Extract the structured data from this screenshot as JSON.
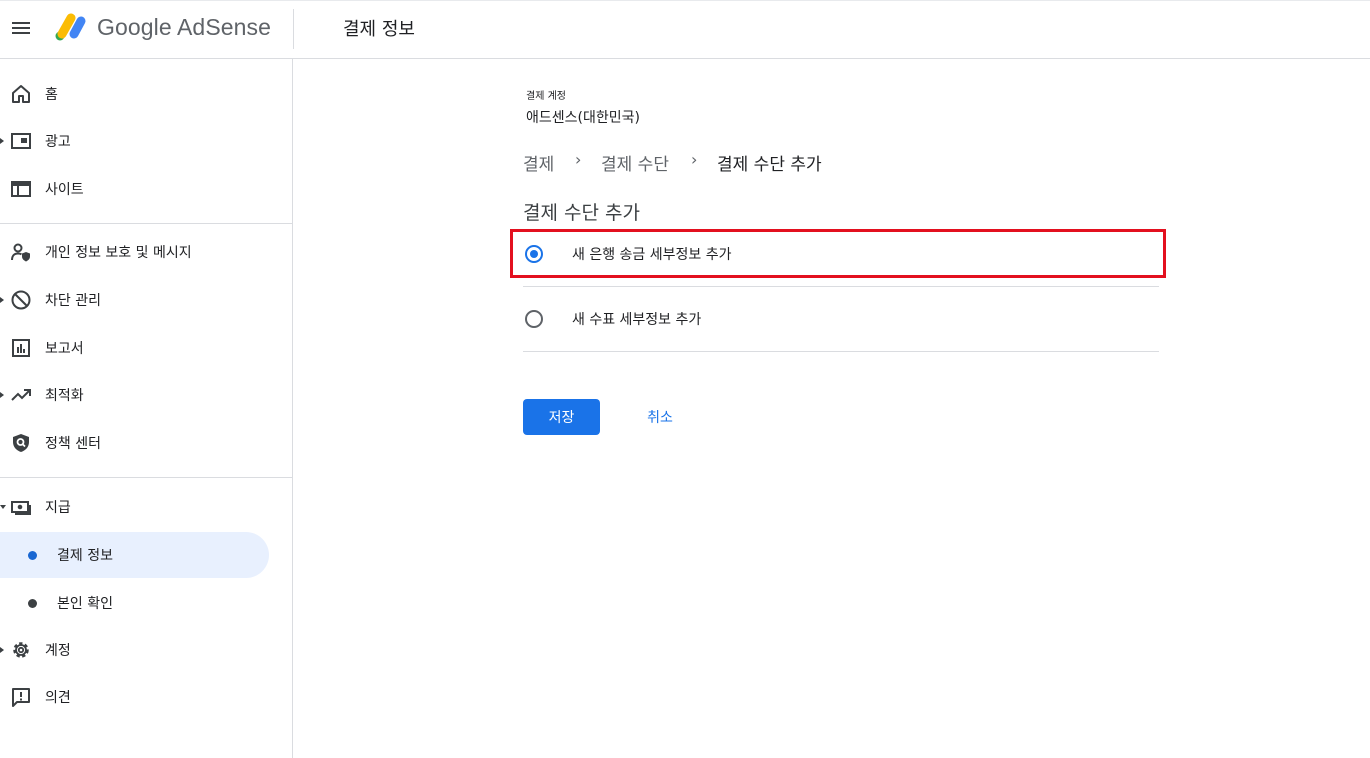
{
  "app": {
    "logo_text": "Google AdSense",
    "page_title": "결제 정보"
  },
  "colors": {
    "accent": "#1a73e8",
    "active_bg": "#e8f0fe",
    "highlight_border": "#e3101f",
    "logo_yellow": "#fbbc04",
    "logo_blue": "#4285f4",
    "logo_green": "#34a853"
  },
  "sidebar": {
    "items": [
      {
        "label": "홈",
        "icon": "home-icon"
      },
      {
        "label": "광고",
        "icon": "ads-icon",
        "caret": "right"
      },
      {
        "label": "사이트",
        "icon": "sites-icon"
      },
      {
        "label": "개인 정보 보호 및 메시지",
        "icon": "privacy-icon"
      },
      {
        "label": "차단 관리",
        "icon": "block-icon",
        "caret": "right"
      },
      {
        "label": "보고서",
        "icon": "reports-icon"
      },
      {
        "label": "최적화",
        "icon": "optimization-icon",
        "caret": "right"
      },
      {
        "label": "정책 센터",
        "icon": "policy-shield-icon"
      },
      {
        "label": "지급",
        "icon": "payments-icon",
        "caret": "down"
      },
      {
        "label": "계정",
        "icon": "gear-icon",
        "caret": "right"
      },
      {
        "label": "의견",
        "icon": "feedback-icon"
      }
    ],
    "payments_subitems": [
      {
        "label": "결제 정보",
        "active": true
      },
      {
        "label": "본인 확인",
        "active": false
      }
    ]
  },
  "main": {
    "account_label": "결제 계정",
    "account_name": "애드센스(대한민국)",
    "breadcrumb": [
      "결제",
      "결제 수단",
      "결제 수단 추가"
    ],
    "breadcrumb_separator": "›",
    "section_title": "결제 수단 추가",
    "options": [
      {
        "label": "새 은행 송금 세부정보 추가",
        "selected": true
      },
      {
        "label": "새 수표 세부정보 추가",
        "selected": false
      }
    ],
    "save_label": "저장",
    "cancel_label": "취소"
  }
}
